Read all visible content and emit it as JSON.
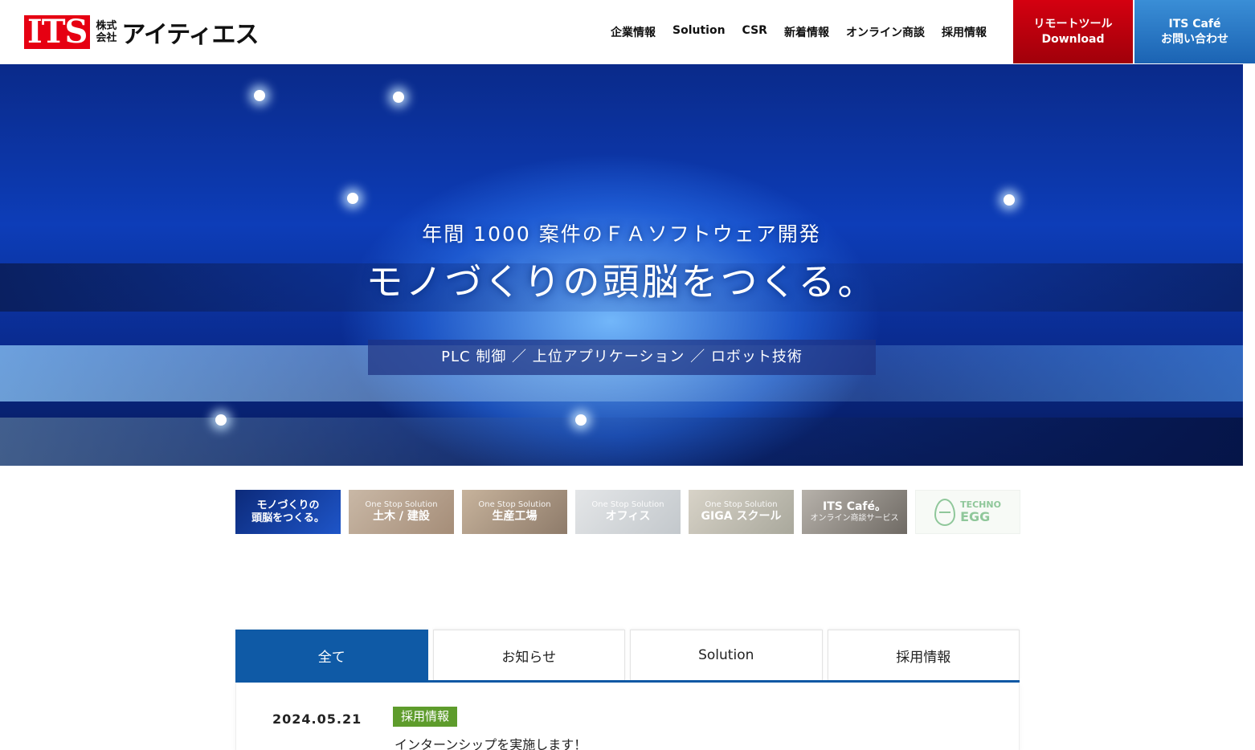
{
  "header": {
    "logo_mark": "ITS",
    "logo_kaisha_1": "株式",
    "logo_kaisha_2": "会社",
    "logo_name": "アイティエス",
    "nav": [
      "企業情報",
      "Solution",
      "CSR",
      "新着情報",
      "オンライン商談",
      "採用情報"
    ],
    "remote_button": {
      "line1": "リモートツール",
      "line2": "Download"
    },
    "cafe_button": {
      "line1": "ITS Café",
      "line2": "お問い合わせ"
    }
  },
  "hero": {
    "subtitle": "年間 1000 案件のＦＡソフトウェア開発",
    "title": "モノづくりの頭脳をつくる。",
    "tagline": "PLC 制御 ／ 上位アプリケーション ／ ロボット技術"
  },
  "thumbnails": [
    {
      "small": "",
      "big_1": "モノづくりの",
      "big_2": "頭脳をつくる。"
    },
    {
      "small": "One Stop Solution",
      "big_1": "土木 / 建設",
      "big_2": ""
    },
    {
      "small": "One Stop Solution",
      "big_1": "生産工場",
      "big_2": ""
    },
    {
      "small": "One Stop Solution",
      "big_1": "オフィス",
      "big_2": ""
    },
    {
      "small": "One Stop Solution",
      "big_1": "GIGA スクール",
      "big_2": ""
    },
    {
      "small": "",
      "big_1": "ITS Café。",
      "big_2": "オンライン商談サービス"
    },
    {
      "small": "TECHNO",
      "big_1": "EGG",
      "big_2": ""
    }
  ],
  "news_tabs": [
    "全て",
    "お知らせ",
    "Solution",
    "採用情報"
  ],
  "news_items": [
    {
      "date": "2024.05.21",
      "category": "採用情報",
      "title": "インターンシップを実施します！"
    }
  ],
  "colors": {
    "brand_red": "#e60012",
    "tab_blue": "#0f5aa6",
    "badge_green": "#5e9c2c"
  }
}
